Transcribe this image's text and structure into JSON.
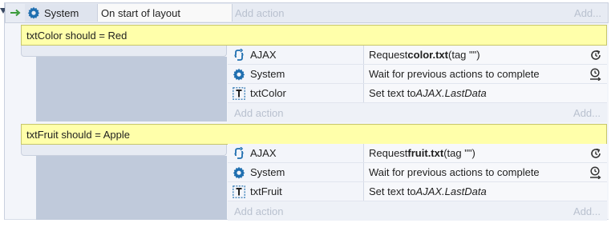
{
  "event": {
    "object": "System",
    "condition": "On start of layout",
    "add_action": "Add action",
    "add_right": "Add..."
  },
  "subevents": [
    {
      "comment": "txtColor should = Red",
      "actions": [
        {
          "object": "AJAX",
          "icon": "ajax-icon",
          "pre": "Request ",
          "bold": "color.txt",
          "post": " (tag \"\")",
          "flag": "async-icon"
        },
        {
          "object": "System",
          "icon": "gear-icon",
          "text": "Wait for previous actions to complete",
          "flag": "wait-icon"
        },
        {
          "object": "txtColor",
          "icon": "text-object-icon",
          "pre": "Set text to ",
          "italic": "AJAX.LastData"
        }
      ],
      "add_action": "Add action",
      "add_right": "Add..."
    },
    {
      "comment": "txtFruit should = Apple",
      "actions": [
        {
          "object": "AJAX",
          "icon": "ajax-icon",
          "pre": "Request ",
          "bold": "fruit.txt",
          "post": " (tag \"\")",
          "flag": "async-icon"
        },
        {
          "object": "System",
          "icon": "gear-icon",
          "text": "Wait for previous actions to complete",
          "flag": "wait-icon"
        },
        {
          "object": "txtFruit",
          "icon": "text-object-icon",
          "pre": "Set text to ",
          "italic": "AJAX.LastData"
        }
      ],
      "add_action": "Add action",
      "add_right": "Add..."
    }
  ],
  "colors": {
    "comment_bg": "#ffffaa",
    "condition_area": "#c0cadb",
    "icon_blue": "#1f6fb0",
    "add_text": "#b9c1cf"
  }
}
